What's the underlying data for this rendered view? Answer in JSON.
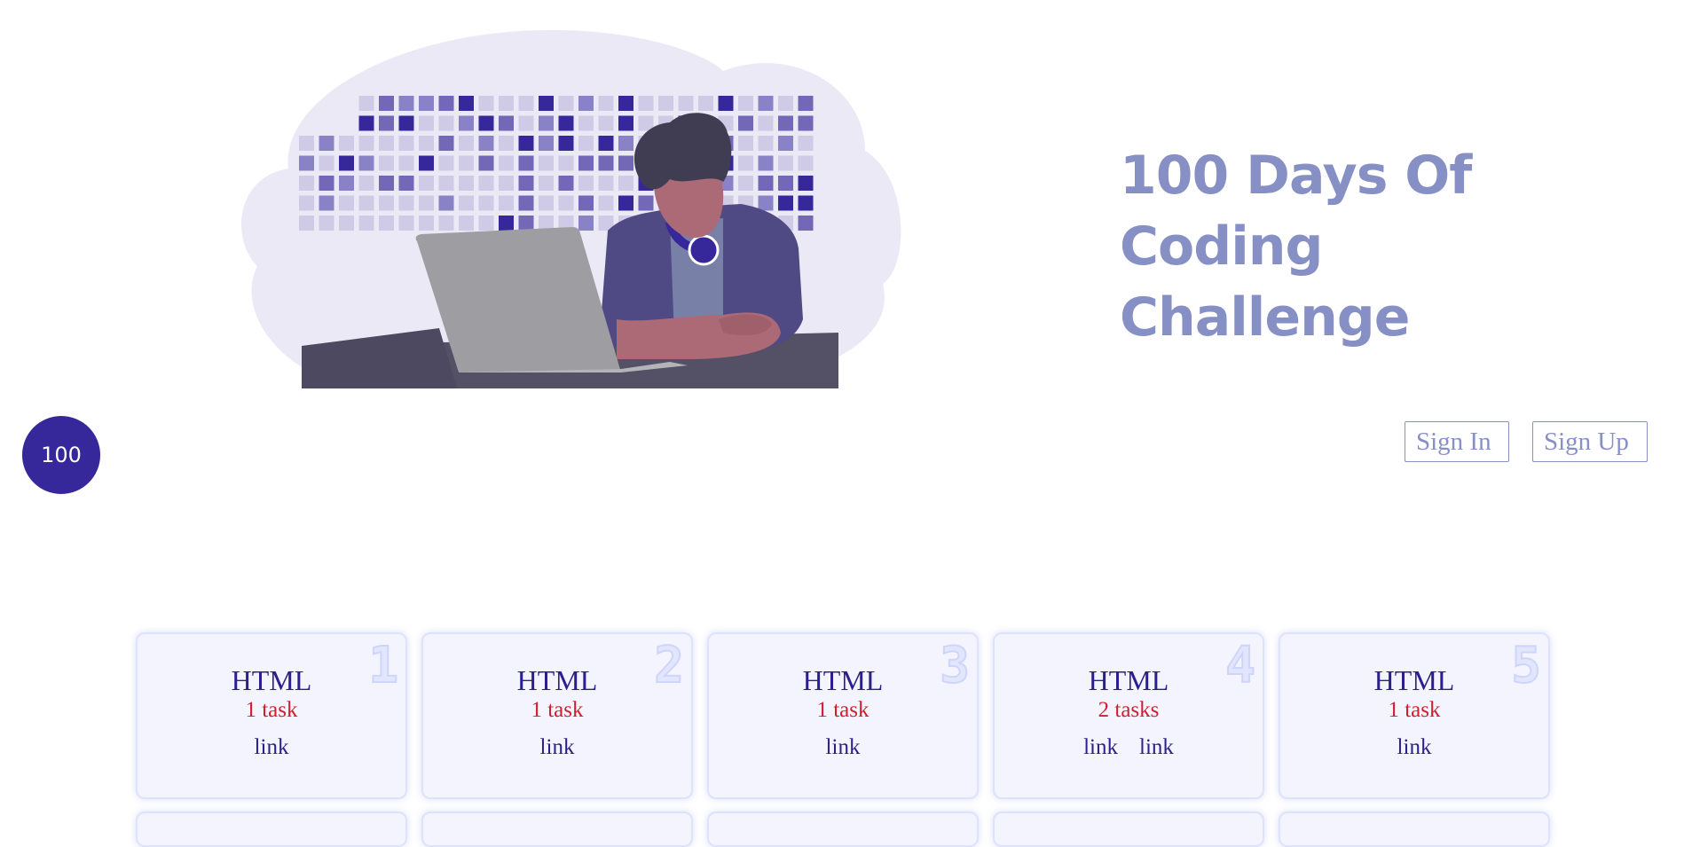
{
  "hero": {
    "title": "100 Days Of Coding Challenge"
  },
  "badge": {
    "label": "100"
  },
  "auth": {
    "sign_in": "Sign In",
    "sign_up": "Sign Up"
  },
  "cards": [
    {
      "number": "1",
      "topic": "HTML",
      "tasks": "1 task",
      "links": [
        "link"
      ]
    },
    {
      "number": "2",
      "topic": "HTML",
      "tasks": "1 task",
      "links": [
        "link"
      ]
    },
    {
      "number": "3",
      "topic": "HTML",
      "tasks": "1 task",
      "links": [
        "link"
      ]
    },
    {
      "number": "4",
      "topic": "HTML",
      "tasks": "2 tasks",
      "links": [
        "link",
        "link"
      ]
    },
    {
      "number": "5",
      "topic": "HTML",
      "tasks": "1 task",
      "links": [
        "link"
      ]
    }
  ],
  "colors": {
    "accent": "#36279a",
    "title": "#8690c4",
    "task_red": "#d11e2e",
    "card_bg": "#f3f4fd"
  }
}
